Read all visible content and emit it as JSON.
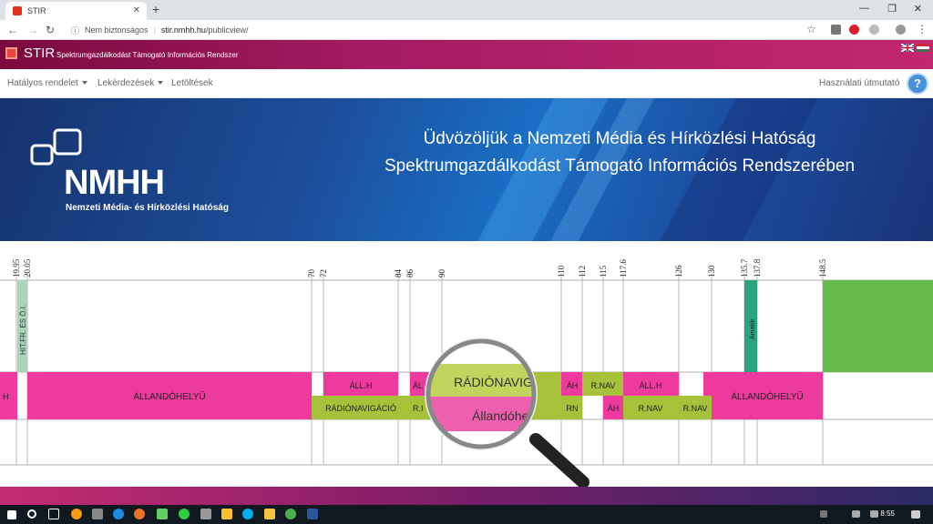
{
  "browser": {
    "tab_title": "STIR",
    "new_tab": "+",
    "security_label": "Nem biztonságos",
    "url_host": "stir.nmhh.hu",
    "url_path": "/publicview/"
  },
  "header": {
    "app_name": "STIR",
    "app_subtitle": "Spektrumgazdálkodást Támogató Információs Rendszer"
  },
  "menu": {
    "items": [
      {
        "label": "Hatályos rendelet",
        "dropdown": true
      },
      {
        "label": "Lekérdezések",
        "dropdown": true
      },
      {
        "label": "Letöltések",
        "dropdown": false
      }
    ],
    "help_label": "Használati útmutató",
    "help_icon": "?"
  },
  "banner": {
    "welcome_line1": "Üdvözöljük a Nemzeti Média és Hírközlési Hatóság",
    "welcome_line2": "Spektrumgazdálkodást Támogató Információs Rendszerében",
    "logo_letters": "NMHH",
    "logo_fullname": "Nemzeti Média- és Hírközlési Hatóság"
  },
  "colors": {
    "brand_magenta": "#a51b63",
    "band_pink": "#ee3a9e",
    "band_olive": "#a6c13a",
    "band_green": "#66bb4a",
    "band_teal": "#2aa37f"
  },
  "chart_data": {
    "type": "frequency-allocation",
    "ticks": [
      "19.95",
      "20.05",
      "70",
      "72",
      "84",
      "86",
      "90",
      "110",
      "112",
      "115",
      "117.6",
      "126",
      "130",
      "135.7",
      "137.8",
      "148.5"
    ],
    "row1_labels": [
      "HIT.FR. ÉS Ö.I.",
      "Amatőr"
    ],
    "row2_top": [
      "H",
      "ÁLLANDÓHELYŰ",
      "ÁLL.H",
      "ÁL",
      "ÁH",
      "R.NAV",
      "ÁLL.H",
      "ÁLLANDÓHELYŰ"
    ],
    "row2_bottom": [
      "RÁDIÓNAVIGÁCIÓ",
      "R.I",
      "RN",
      "ÁH",
      "R.NAV",
      "R.NAV"
    ],
    "magnifier": [
      "RÁDIÓNAVIGÁ",
      "Állandóhel"
    ]
  },
  "taskbar": {
    "time": "8:55"
  }
}
